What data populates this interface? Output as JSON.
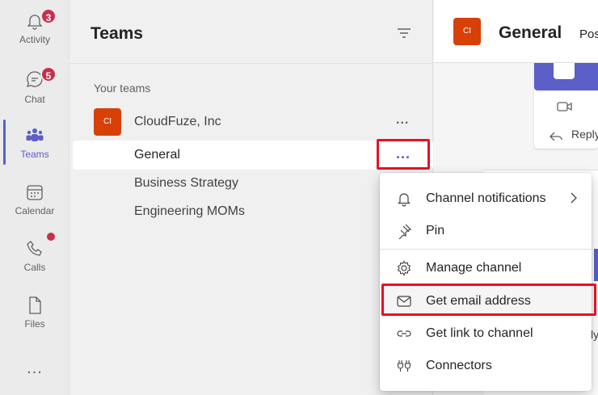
{
  "rail": {
    "items": [
      {
        "id": "activity",
        "label": "Activity",
        "icon": "bell-icon",
        "badge": "3"
      },
      {
        "id": "chat",
        "label": "Chat",
        "icon": "chat-icon",
        "badge": "5"
      },
      {
        "id": "teams",
        "label": "Teams",
        "icon": "teams-icon",
        "active": true
      },
      {
        "id": "calendar",
        "label": "Calendar",
        "icon": "calendar-icon"
      },
      {
        "id": "calls",
        "label": "Calls",
        "icon": "phone-icon",
        "dot": true
      },
      {
        "id": "files",
        "label": "Files",
        "icon": "file-icon"
      }
    ],
    "more": "..."
  },
  "panel": {
    "title": "Teams",
    "section_label": "Your teams",
    "team": {
      "avatar": "CI",
      "name": "CloudFuze, Inc",
      "more": "..."
    },
    "channels": [
      "General",
      "Business Strategy",
      "Engineering MOMs"
    ],
    "selected_more": "..."
  },
  "content": {
    "avatar": "CI",
    "title": "General",
    "tab": "Pos",
    "reply": "Reply",
    "peek": [
      "1",
      "e",
      "ly"
    ]
  },
  "menu": {
    "items": [
      {
        "label": "Channel notifications",
        "icon": "bell-icon",
        "submenu": true
      },
      {
        "label": "Pin",
        "icon": "pin-icon"
      },
      {
        "label": "Manage channel",
        "icon": "gear-icon"
      },
      {
        "label": "Get email address",
        "icon": "mail-icon"
      },
      {
        "label": "Get link to channel",
        "icon": "link-icon"
      },
      {
        "label": "Connectors",
        "icon": "connector-icon"
      }
    ]
  },
  "colors": {
    "accent": "#5b5fc7",
    "team_avatar": "#d74108",
    "badge": "#c4314b",
    "highlight": "#e81123"
  }
}
